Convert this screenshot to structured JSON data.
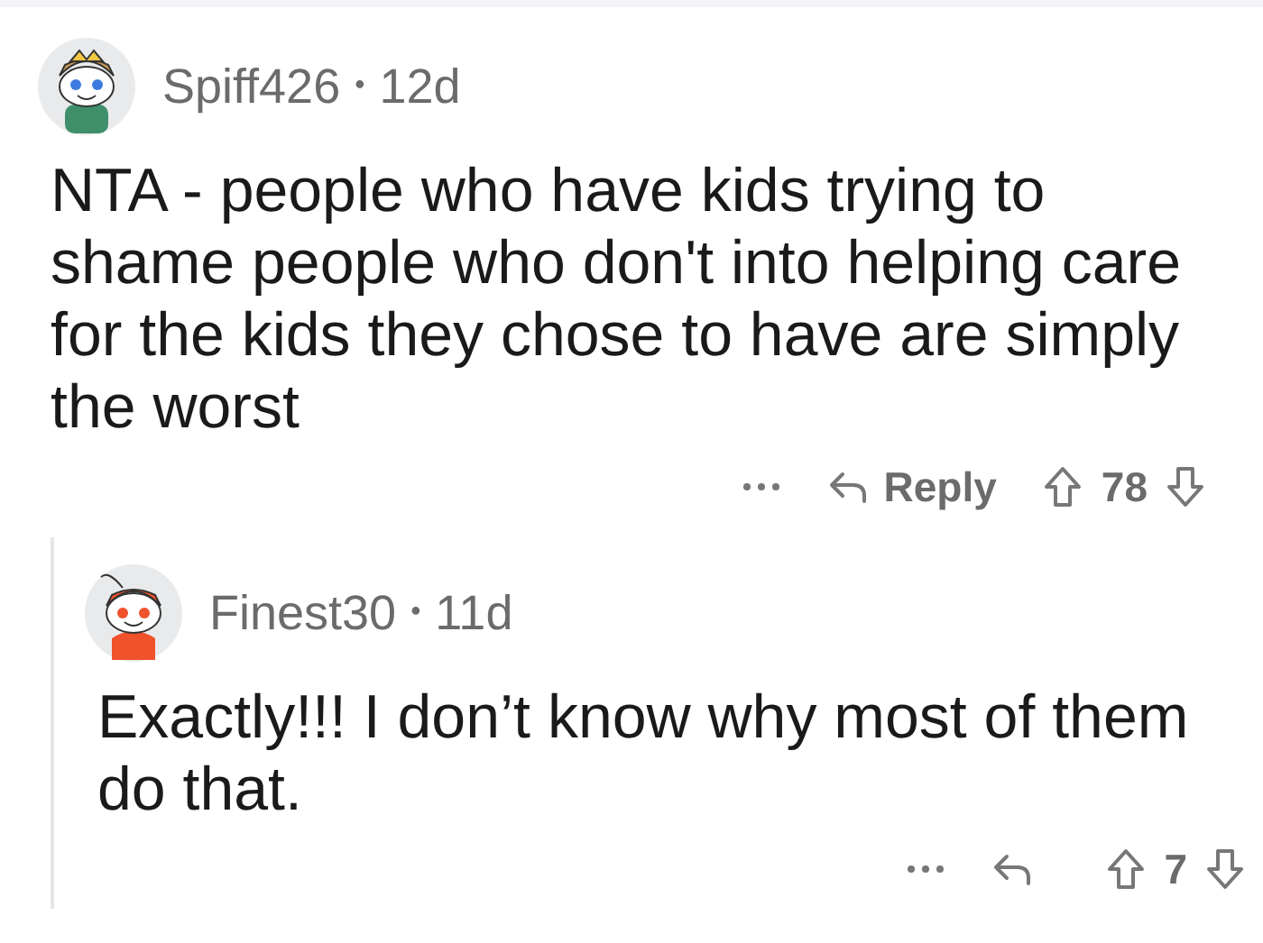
{
  "comment": {
    "author": "Spiff426",
    "separator": "•",
    "age": "12d",
    "body": "NTA - people who have kids trying to shame people who don't into helping care for the kids they chose to have are simply the worst",
    "reply_label": "Reply",
    "score": "78",
    "replies": [
      {
        "author": "Finest30",
        "separator": "•",
        "age": "11d",
        "body": "Exactly!!! I don’t know why most of them do that.",
        "score": "7"
      }
    ]
  }
}
